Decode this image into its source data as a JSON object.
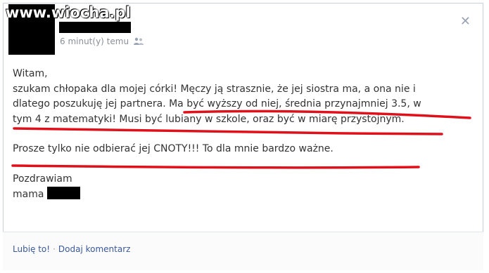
{
  "watermark": "www.wiocha.pl",
  "post_meta": {
    "time": "6 minut(y) temu"
  },
  "icons": {
    "close": "close-icon",
    "audience": "people-icon"
  },
  "post": {
    "greeting": "Witam,",
    "line1": "szukam chłopaka dla mojej córki! Męczy ją strasznie, że jej siostra ma, a ona nie i",
    "line2": "dlatego poszukuję jej partnera. Ma być wyższy od niej, średnia przynajmniej 3.5, w",
    "line3": "tym 4 z matematyki! Musi być lubiany w szkole, oraz być w miarę przystojnym.",
    "line4": "Prosze tylko nie odbierać jej CNOTY!!! To dla mnie bardzo ważne.",
    "closing": "Pozdrawiam",
    "signature": "mama"
  },
  "footer": {
    "like": "Lubię to!",
    "separator": "·",
    "comment": "Dodaj komentarz"
  },
  "colors": {
    "underline": "#e0101a",
    "link": "#3b5998",
    "meta": "#8a8f99"
  }
}
